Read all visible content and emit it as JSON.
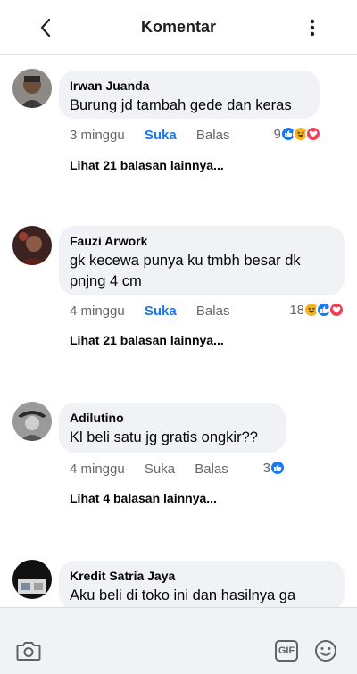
{
  "header": {
    "title": "Komentar"
  },
  "comments": [
    {
      "name": "Irwan Juanda",
      "text": "Burung jd tambah gede dan keras",
      "time": "3 minggu",
      "like": "Suka",
      "reply": "Balas",
      "reaction_count": "9",
      "reactions": [
        "like-icon",
        "haha-icon",
        "love-icon"
      ],
      "replies_link": "Lihat 21 balasan lainnya..."
    },
    {
      "name": "Fauzi Arwork",
      "text": "gk kecewa punya ku tmbh besar dk pnjng 4 cm",
      "time": "4 minggu",
      "like": "Suka",
      "reply": "Balas",
      "reaction_count": "18",
      "reactions": [
        "haha-icon",
        "like-icon",
        "love-icon"
      ],
      "replies_link": "Lihat 21 balasan lainnya..."
    },
    {
      "name": "Adilutino",
      "text": "Kl beli satu jg gratis ongkir??",
      "time": "4 minggu",
      "like": "Suka",
      "reply": "Balas",
      "reaction_count": "3",
      "reactions": [
        "like-icon"
      ],
      "replies_link": "Lihat 4 balasan lainnya..."
    },
    {
      "name": "Kredit Satria Jaya",
      "text": "Aku beli di toko ini dan hasilnya ga"
    }
  ],
  "composer": {
    "gif_label": "GIF"
  },
  "colors": {
    "accent": "#1877f2",
    "bubble": "#f0f2f5",
    "meta": "#65676b",
    "love": "#f33e58",
    "haha": "#f7b125"
  }
}
